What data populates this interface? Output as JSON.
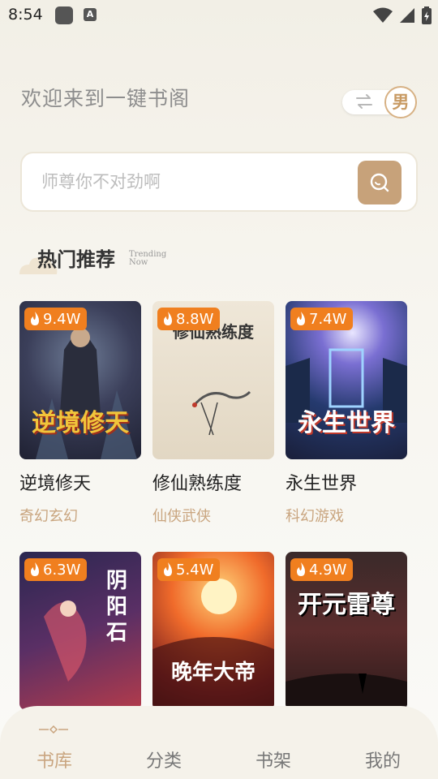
{
  "status_bar": {
    "time": "8:54",
    "app_icons": [
      "square-app-icon",
      "a-app-icon"
    ],
    "app_icon_letter": "A",
    "system_icons": [
      "wifi-icon",
      "signal-icon",
      "battery-icon"
    ]
  },
  "header": {
    "welcome": "欢迎来到一键书阁",
    "gender_label": "男",
    "swap_icon": "swap-arrows-icon"
  },
  "search": {
    "placeholder": "师尊你不对劲啊",
    "button_icon": "search-icon"
  },
  "section": {
    "title": "热门推荐",
    "subtitle": "Trending Now"
  },
  "books": [
    {
      "title": "逆境修天",
      "category": "奇幻玄幻",
      "heat": "9.4W",
      "cover_text": "逆境修天"
    },
    {
      "title": "修仙熟练度",
      "category": "仙侠武侠",
      "heat": "8.8W",
      "cover_text": "修仙熟练度"
    },
    {
      "title": "永生世界",
      "category": "科幻游戏",
      "heat": "7.4W",
      "cover_text": "永生世界"
    },
    {
      "title": "",
      "category": "",
      "heat": "6.3W",
      "cover_text": "阴阳石"
    },
    {
      "title": "",
      "category": "",
      "heat": "5.4W",
      "cover_text": "晚年大帝"
    },
    {
      "title": "",
      "category": "",
      "heat": "4.9W",
      "cover_text": "开元雷尊"
    }
  ],
  "tabs": [
    {
      "label": "书库",
      "active": true
    },
    {
      "label": "分类",
      "active": false
    },
    {
      "label": "书架",
      "active": false
    },
    {
      "label": "我的",
      "active": false
    }
  ],
  "colors": {
    "accent": "#c9a57f",
    "heat_badge": "#f07f1f",
    "search_button": "#c7a27a"
  }
}
